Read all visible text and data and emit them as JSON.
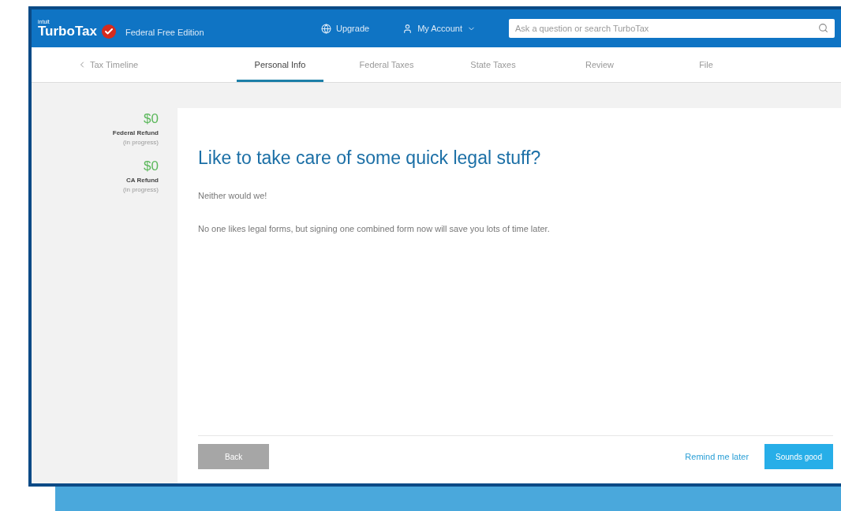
{
  "header": {
    "brand_small": "intuit",
    "brand": "TurboTax",
    "edition": "Federal Free Edition",
    "upgrade": "Upgrade",
    "account": "My Account",
    "search": {
      "placeholder": "Ask a question or search TurboTax"
    }
  },
  "nav": {
    "back": "Tax Timeline",
    "tabs": [
      {
        "label": "Personal Info",
        "selected": true
      },
      {
        "label": "Federal Taxes",
        "selected": false
      },
      {
        "label": "State Taxes",
        "selected": false
      },
      {
        "label": "Review",
        "selected": false
      },
      {
        "label": "File",
        "selected": false
      }
    ]
  },
  "refunds": [
    {
      "amount": "$0",
      "label": "Federal Refund",
      "status": "(in progress)"
    },
    {
      "amount": "$0",
      "label": "CA Refund",
      "status": "(in progress)"
    }
  ],
  "content": {
    "heading": "Like to take care of some quick legal stuff?",
    "paragraphs": [
      "Neither would we!",
      "No one likes legal forms, but signing one combined form now will save you lots of time later."
    ]
  },
  "footer": {
    "back": "Back",
    "remind": "Remind me later",
    "confirm": "Sounds good"
  }
}
